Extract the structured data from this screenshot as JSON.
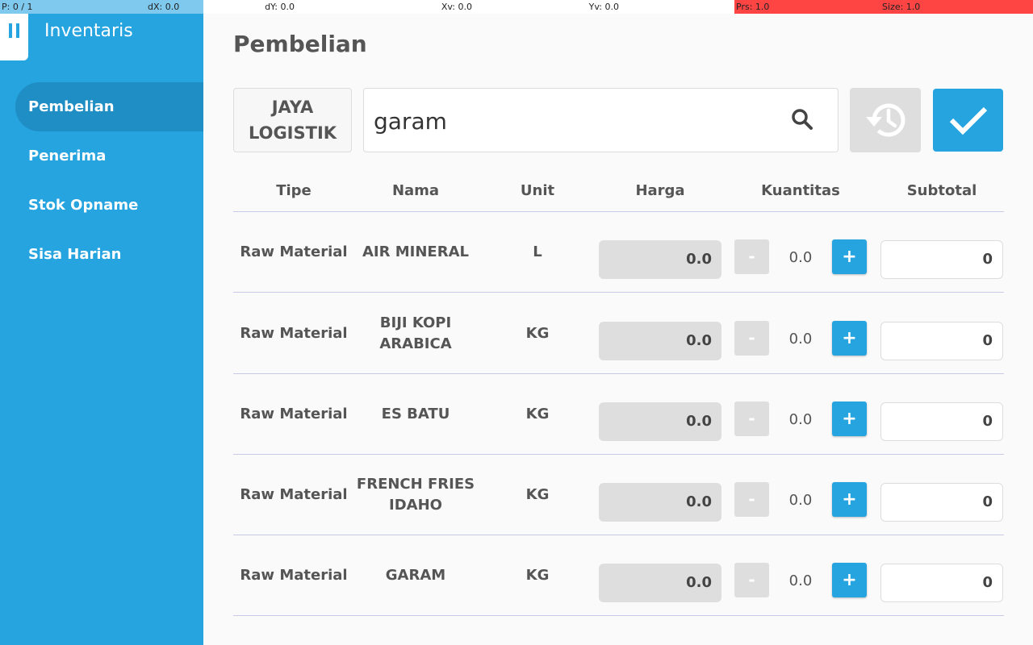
{
  "debug": {
    "p": "P: 0 / 1",
    "dx": "dX: 0.0",
    "dy": "dY: 0.0",
    "xv": "Xv: 0.0",
    "yv": "Yv: 0.0",
    "prs": "Prs: 1.0",
    "size": "Size: 1.0"
  },
  "sidebar": {
    "title": "Inventaris",
    "items": [
      {
        "label": "Pembelian",
        "active": true
      },
      {
        "label": "Penerima",
        "active": false
      },
      {
        "label": "Stok Opname",
        "active": false
      },
      {
        "label": "Sisa Harian",
        "active": false
      }
    ]
  },
  "page": {
    "title": "Pembelian",
    "vendor_label": "JAYA LOGISTIK",
    "search_value": "garam"
  },
  "table": {
    "headers": {
      "tipe": "Tipe",
      "nama": "Nama",
      "unit": "Unit",
      "harga": "Harga",
      "kuantitas": "Kuantitas",
      "subtotal": "Subtotal"
    },
    "rows": [
      {
        "tipe": "Raw Material",
        "nama": "AIR MINERAL",
        "unit": "L",
        "harga": "0.0",
        "qty": "0.0",
        "subtotal": "0"
      },
      {
        "tipe": "Raw Material",
        "nama": "BIJI KOPI ARABICA",
        "unit": "KG",
        "harga": "0.0",
        "qty": "0.0",
        "subtotal": "0"
      },
      {
        "tipe": "Raw Material",
        "nama": "ES BATU",
        "unit": "KG",
        "harga": "0.0",
        "qty": "0.0",
        "subtotal": "0"
      },
      {
        "tipe": "Raw Material",
        "nama": "FRENCH FRIES IDAHO",
        "unit": "KG",
        "harga": "0.0",
        "qty": "0.0",
        "subtotal": "0"
      },
      {
        "tipe": "Raw Material",
        "nama": "GARAM",
        "unit": "KG",
        "harga": "0.0",
        "qty": "0.0",
        "subtotal": "0"
      }
    ],
    "minus_label": "-",
    "plus_label": "+"
  },
  "colors": {
    "accent": "#26a4e0",
    "sidebar_active": "#1f8ec5",
    "disabled": "#dedede"
  },
  "icons": {
    "menu": "menu-icon",
    "search": "search-icon",
    "history": "history-icon",
    "confirm": "check-icon"
  }
}
